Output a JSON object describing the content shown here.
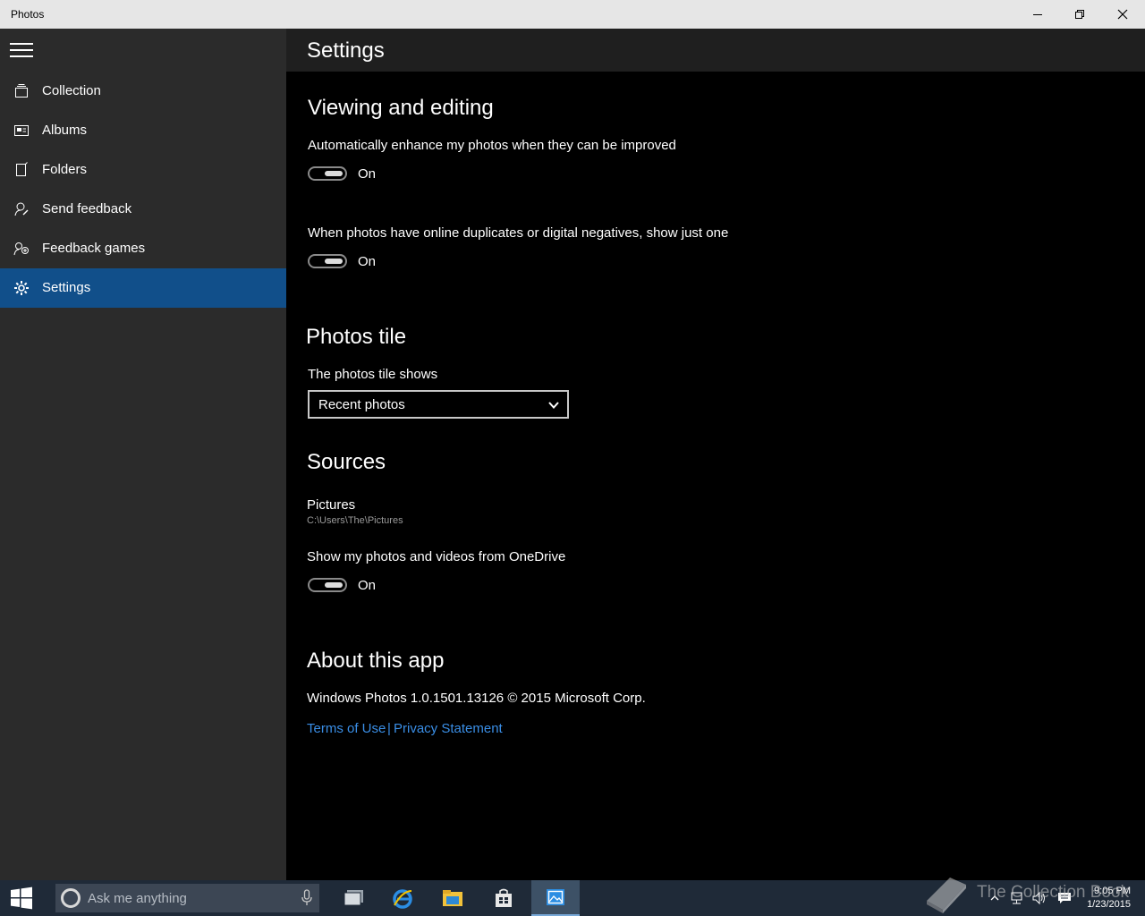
{
  "window": {
    "title": "Photos"
  },
  "sidebar": {
    "items": [
      {
        "label": "Collection",
        "icon": "collection-icon"
      },
      {
        "label": "Albums",
        "icon": "album-icon"
      },
      {
        "label": "Folders",
        "icon": "folder-icon"
      },
      {
        "label": "Send feedback",
        "icon": "feedback-icon"
      },
      {
        "label": "Feedback games",
        "icon": "games-icon"
      },
      {
        "label": "Settings",
        "icon": "gear-icon",
        "active": true
      }
    ]
  },
  "header": {
    "title": "Settings"
  },
  "viewing": {
    "heading": "Viewing and editing",
    "enhance_label": "Automatically enhance my photos when they can be improved",
    "enhance_state": "On",
    "duplicates_label": "When photos have online duplicates or digital negatives, show just one",
    "duplicates_state": "On"
  },
  "tile": {
    "heading": "Photos tile",
    "label": "The photos tile shows",
    "selected": "Recent photos"
  },
  "sources": {
    "heading": "Sources",
    "folder_name": "Pictures",
    "folder_path": "C:\\Users\\The\\Pictures",
    "onedrive_label": "Show my photos and videos from OneDrive",
    "onedrive_state": "On"
  },
  "about": {
    "heading": "About this app",
    "version": "Windows Photos 1.0.1501.13126 © 2015 Microsoft Corp.",
    "terms": "Terms of Use",
    "separator": "|",
    "privacy": "Privacy Statement"
  },
  "taskbar": {
    "search_placeholder": "Ask me anything",
    "time": "9:05 PM",
    "date": "1/23/2015",
    "watermark": "The Collection Book"
  },
  "colors": {
    "accent": "#114f8a",
    "link": "#3a8ee6",
    "sidebar": "#2b2b2b"
  }
}
